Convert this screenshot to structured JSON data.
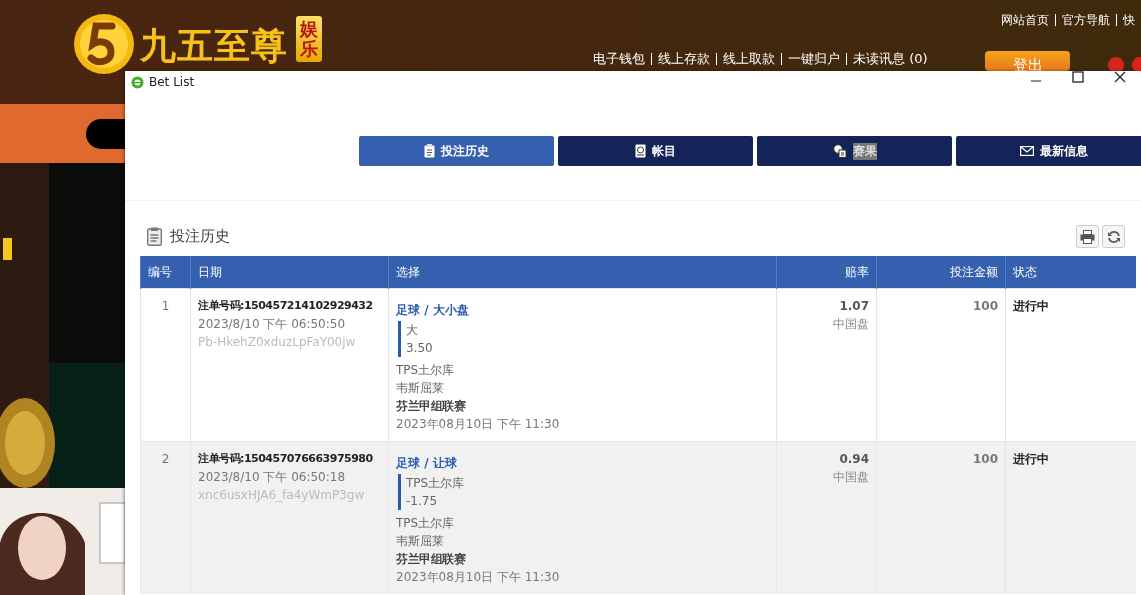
{
  "site": {
    "logo_title": "九五至尊",
    "logo_badge": "娱乐",
    "top_links": [
      "网站首页",
      "官方导航",
      "快"
    ],
    "account_links": [
      "电子钱包",
      "线上存款",
      "线上取款",
      "一键归户",
      "未读讯息 (0)"
    ],
    "logout": "登出",
    "banner": {
      "kind": "picture"
    }
  },
  "window": {
    "title": "Bet List",
    "tabs": [
      {
        "label": "投注历史",
        "selected": true,
        "highlighted": false,
        "kind": "history"
      },
      {
        "label": "帐目",
        "selected": false,
        "highlighted": false,
        "kind": "statement"
      },
      {
        "label": "赛果",
        "selected": false,
        "highlighted": true,
        "kind": "results"
      },
      {
        "label": "最新信息",
        "selected": false,
        "highlighted": false,
        "kind": "mail"
      }
    ],
    "section_title": "投注历史",
    "table": {
      "columns": [
        "编号",
        "日期",
        "选择",
        "赔率",
        "投注金额",
        "状态"
      ],
      "rows": [
        {
          "number": "1",
          "ticket": "注单号码:150457214102929432",
          "placed": "2023/8/10 下午 06:50:50",
          "reference": "Pb-HkehZ0xduzLpFaY00jw",
          "market": "足球 / 大小盘",
          "selection": [
            "大",
            "3.50"
          ],
          "teams": [
            "TPS土尔库",
            "韦斯屈莱"
          ],
          "league": "芬兰甲组联赛",
          "kickoff": "2023年08月10日 下午 11:30",
          "odds": "1.07",
          "odds_type": "中国盘",
          "stake": "100",
          "status": "进行中"
        },
        {
          "number": "2",
          "ticket": "注单号码:150457076663975980",
          "placed": "2023/8/10 下午 06:50:18",
          "reference": "xnc6usxHJA6_fa4yWmP3gw",
          "market": "足球 / 让球",
          "selection": [
            "TPS土尔库",
            "-1.75"
          ],
          "teams": [
            "TPS土尔库",
            "韦斯屈莱"
          ],
          "league": "芬兰甲组联赛",
          "kickoff": "2023年08月10日 下午 11:30",
          "odds": "0.94",
          "odds_type": "中国盘",
          "stake": "100",
          "status": "进行中"
        }
      ]
    }
  }
}
